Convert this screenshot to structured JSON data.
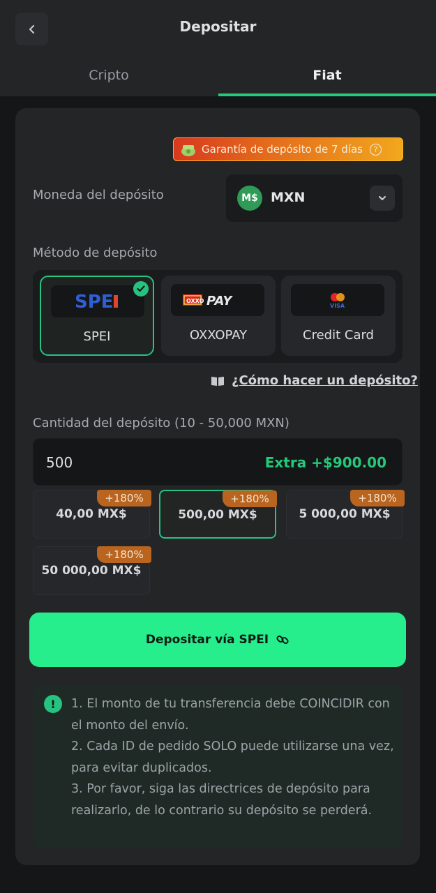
{
  "header": {
    "title": "Depositar",
    "tabs": [
      {
        "label": "Cripto",
        "active": false
      },
      {
        "label": "Fiat",
        "active": true
      }
    ]
  },
  "guarantee": {
    "text": "Garantía de depósito de 7 días",
    "help": "?"
  },
  "currency": {
    "label": "Moneda del depósito",
    "icon_text": "M$",
    "value": "MXN"
  },
  "method": {
    "label": "Método de depósito",
    "options": [
      {
        "label": "SPEI",
        "logo": "SPEI",
        "selected": true
      },
      {
        "label": "OXXOPAY",
        "logo": "OXXO PAY",
        "selected": false
      },
      {
        "label": "Credit Card",
        "logo": "VISA",
        "selected": false
      }
    ]
  },
  "howto": {
    "text": "¿Cómo hacer un depósito?"
  },
  "amount": {
    "label": "Cantidad del depósito (10 - 50,000 MXN)",
    "value": "500",
    "extra": "Extra +$900.00",
    "presets": [
      {
        "value": "40,00 MX$",
        "bonus": "+180%",
        "selected": false
      },
      {
        "value": "500,00 MX$",
        "bonus": "+180%",
        "selected": true
      },
      {
        "value": "5 000,00 MX$",
        "bonus": "+180%",
        "selected": false
      },
      {
        "value": "50 000,00 MX$",
        "bonus": "+180%",
        "selected": false
      }
    ]
  },
  "cta": {
    "label": "Depositar vía SPEI"
  },
  "notice": {
    "lines": [
      "1. El monto de tu transferencia debe COINCIDIR con el monto del envío.",
      "2. Cada ID de pedido SOLO puede utilizarse una vez, para evitar duplicados.",
      "3. Por favor, siga las directrices de depósito para realizarlo, de lo contrario su depósito se perderá."
    ]
  },
  "colors": {
    "accent": "#27ee8c",
    "success": "#24c97a",
    "bonus_badge": "#b9641f",
    "card": "#232527"
  }
}
